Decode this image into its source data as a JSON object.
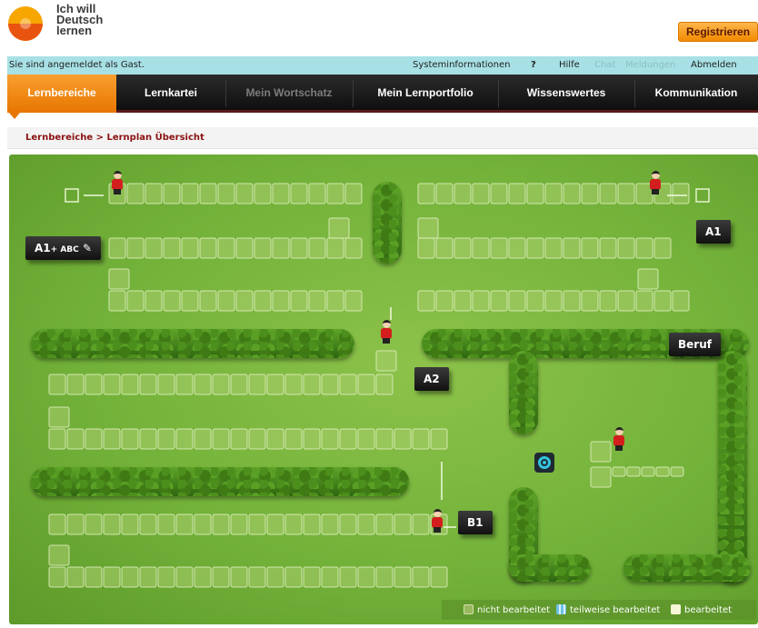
{
  "header": {
    "logo_lines": [
      "Ich will",
      "Deutsch",
      "lernen"
    ],
    "register_label": "Registrieren"
  },
  "statusbar": {
    "guest_text": "Sie sind angemeldet als Gast.",
    "links": [
      "Systeminformationen",
      "?",
      "Hilfe",
      "Chat",
      "Meldungen",
      "Abmelden"
    ]
  },
  "nav": {
    "tabs": [
      "Lernbereiche",
      "Lernkartei",
      "Mein Wortschatz",
      "Mein Lernportfolio",
      "Wissenswertes",
      "Kommunikation"
    ],
    "active": "Lernbereiche"
  },
  "breadcrumb": "Lernbereiche > Lernplan Übersicht",
  "map": {
    "badges": {
      "a1abc": "A1",
      "abc": "+ ABC",
      "a1": "A1",
      "a2": "A2",
      "beruf": "Beruf",
      "b1": "B1"
    },
    "legend": {
      "not_done": "nicht bearbeitet",
      "partial": "teilweise bearbeitet",
      "done": "bearbeitet"
    }
  },
  "colors": {
    "accent": "#f28a00",
    "status_bar": "#a7e0e5",
    "crumb": "#8b1010",
    "grass": "#73b23a"
  }
}
